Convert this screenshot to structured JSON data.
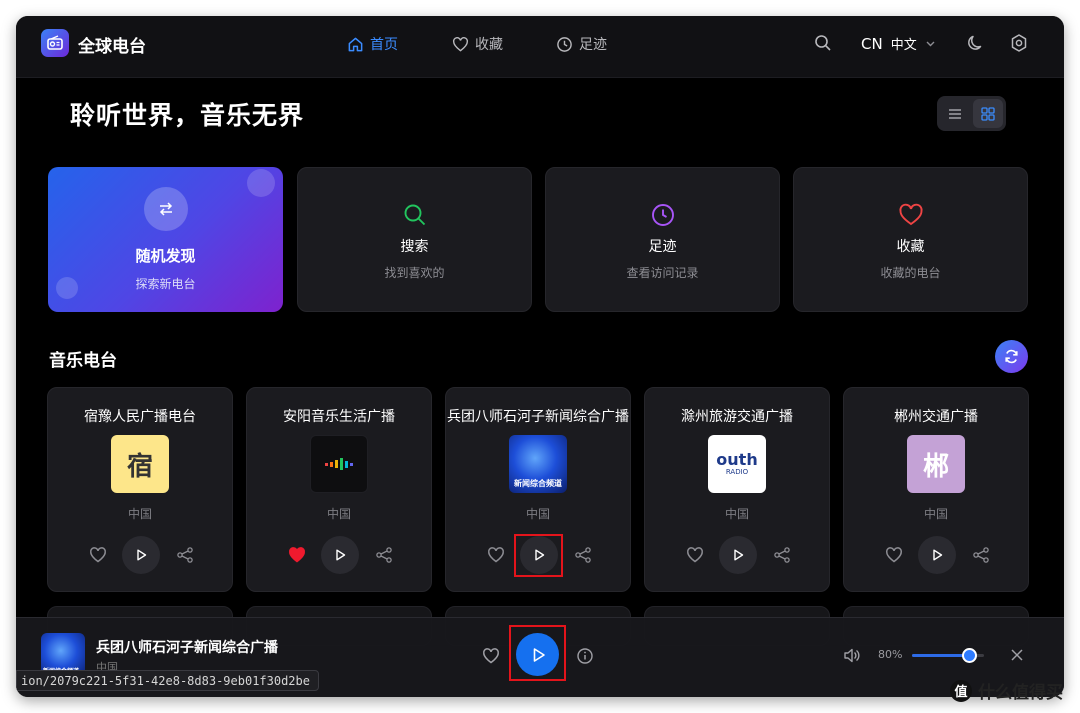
{
  "app": {
    "title": "全球电台"
  },
  "nav": [
    {
      "label": "首页",
      "icon": "home-icon",
      "active": true
    },
    {
      "label": "收藏",
      "icon": "heart-icon",
      "active": false
    },
    {
      "label": "足迹",
      "icon": "clock-icon",
      "active": false
    }
  ],
  "topbar": {
    "lang_code": "CN",
    "lang_name": "中文"
  },
  "headline": "聆听世界，音乐无界",
  "quick_cards": [
    {
      "title": "随机发现",
      "subtitle": "探索新电台",
      "icon": "shuffle-icon"
    },
    {
      "title": "搜索",
      "subtitle": "找到喜欢的",
      "icon": "search-icon",
      "color": "#22c55e"
    },
    {
      "title": "足迹",
      "subtitle": "查看访问记录",
      "icon": "clock-icon",
      "color": "#a855f7"
    },
    {
      "title": "收藏",
      "subtitle": "收藏的电台",
      "icon": "heart-icon",
      "color": "#ef4444"
    }
  ],
  "section": {
    "title": "音乐电台"
  },
  "stations": [
    {
      "name": "宿豫人民广播电台",
      "country": "中国",
      "logo_text": "宿",
      "logo_bg": "#fde68a",
      "logo_fg": "#333333",
      "favorited": false
    },
    {
      "name": "安阳音乐生活广播",
      "country": "中国",
      "logo_text": "",
      "favorited": true
    },
    {
      "name": "兵团八师石河子新闻综合广播",
      "country": "中国",
      "logo_text": "新闻综合频道",
      "favorited": false
    },
    {
      "name": "滁州旅游交通广播",
      "country": "中国",
      "logo_text": "outh",
      "logo_sub": "RADIO",
      "favorited": false
    },
    {
      "name": "郴州交通广播",
      "country": "中国",
      "logo_text": "郴",
      "logo_bg": "#c4a2d6",
      "logo_fg": "#ffffff",
      "favorited": false
    }
  ],
  "player": {
    "station_name": "兵团八师石河子新闻综合广播",
    "country": "中国",
    "volume_label": "80%",
    "volume": 0.8,
    "logo_text": "新闻综合频道"
  },
  "status_url": "ion/2079c221-5f31-42e8-8d83-9eb01f30d2be",
  "watermark": {
    "badge": "值",
    "text": "什么值得买"
  },
  "colors": {
    "accent": "#1570ef",
    "highlight": "#e4141b",
    "background": "#000000"
  }
}
